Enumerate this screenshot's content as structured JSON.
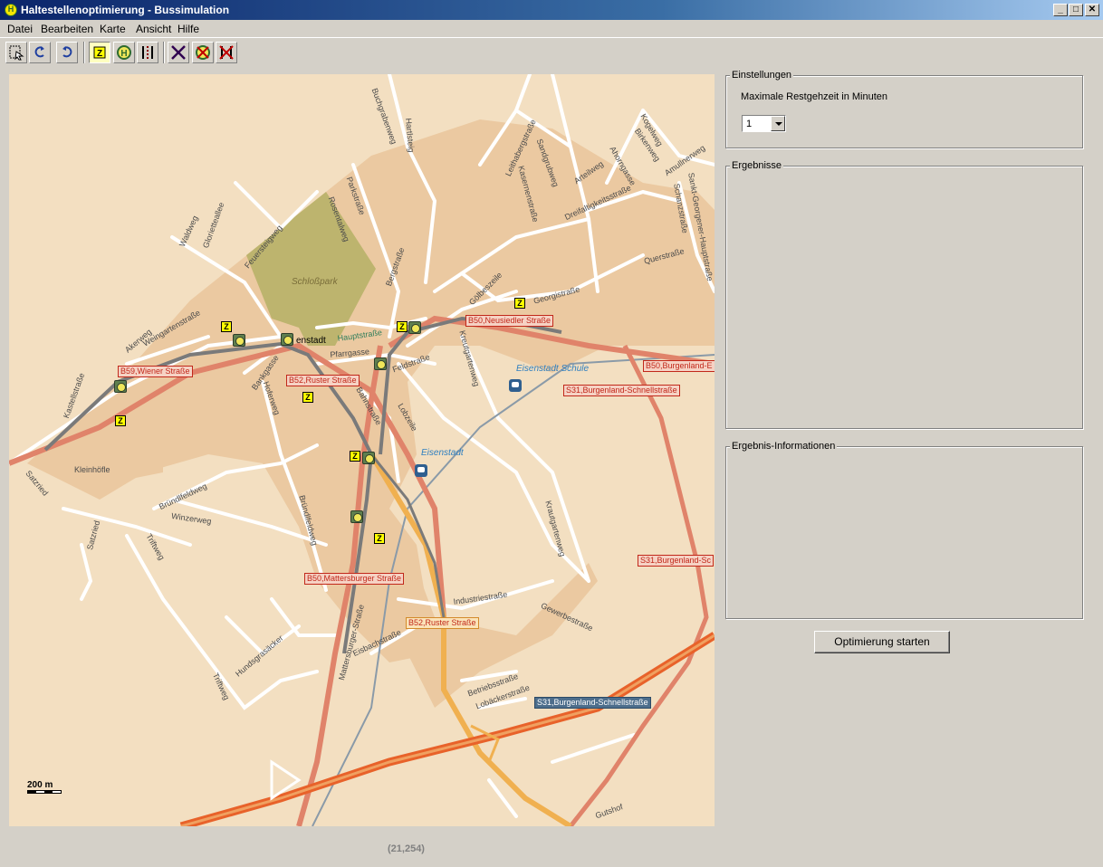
{
  "window": {
    "title": "Haltestellenoptimierung - Bussimulation",
    "app_icon": "H",
    "minimize": "_",
    "maximize": "□",
    "close": "✕"
  },
  "menu": [
    "Datei",
    "Bearbeiten",
    "Karte",
    "Ansicht",
    "Hilfe"
  ],
  "toolbar": {
    "buttons": [
      {
        "icon": "select-icon",
        "active": false
      },
      {
        "icon": "undo-icon",
        "active": false
      },
      {
        "icon": "redo-icon",
        "active": false
      },
      {
        "icon": "z-marker-icon",
        "active": true
      },
      {
        "icon": "bus-stop-icon",
        "active": false
      },
      {
        "icon": "route-icon",
        "active": false
      },
      {
        "icon": "delete-icon",
        "active": false
      },
      {
        "icon": "delete-bus-stop-icon",
        "active": false
      },
      {
        "icon": "delete-route-icon",
        "active": false
      }
    ]
  },
  "map": {
    "park_label": "Schloßpark",
    "town_label": "Eisenstadt",
    "school_label": "Eisenstadt Schule",
    "town_center_label": "enstadt",
    "village_label": "Kleinhöfle",
    "scale_label": "200 m",
    "road_labels": {
      "b59": "B59,Wiener Straße",
      "b50_neusiedler": "B50,Neusiedler Straße",
      "b52_ruster_top": "B52,Ruster Straße",
      "b50_burgenland": "B50,Burgenland-E",
      "s31_top": "S31,Burgenland-Schnellstraße",
      "s31_right": "S31,Burgenland-Sc",
      "b50_mattersburger": "B50,Mattersburger Straße",
      "b52_ruster_bottom": "B52,Ruster Straße",
      "s31_bottom": "S31,Burgenland-Schnellstraße"
    },
    "streets": {
      "buchgrabenweg": "Buchgrabenweg",
      "hartlsteig": "Hartlsteig",
      "leithabergstrasse": "Leithabergstraße",
      "sandgrubweg": "Sandgrubweg",
      "kogelweg": "Kogelweg",
      "birkenweg": "Birkenweg",
      "ahorngasse": "Ahorngasse",
      "arteilweg": "Arteilweg",
      "amullnerweg": "Amullnerweg",
      "parkstrasse": "Parkstraße",
      "rosentalweg": "Rosentalweg",
      "kasernenstrasse": "Kasernenstraße",
      "dreifaltigkeitsstrasse": "Dreifaltigkeitsstraße",
      "schanzstrasse": "Schanzstraße",
      "sankt_georgener": "Sankt-Georgener-Hauptstraße",
      "waldweg": "Waldweg",
      "glorietteallee": "Glorietteallee",
      "feuersteigweg": "Feuersteigweg",
      "bergstrasse": "Bergstraße",
      "querstrasse": "Querstraße",
      "goelbeszeile": "Gölbeszeile",
      "georgistrasse": "Georgistraße",
      "akerweg": "Akerweg",
      "weingartenstrasse": "Weingartenstraße",
      "hauptstrasse": "Hauptstraße",
      "pfarrgasse": "Pfarrgasse",
      "kreutgartenweg": "Kreutgartenweg",
      "feldstrasse": "Feldstraße",
      "bankgasse": "Bankgasse",
      "hoferweg": "Hoferweg",
      "bahnstrasse": "Bahnstraße",
      "lobzeile": "Lobzeile",
      "kastellstrasse": "Kastellstraße",
      "satzried": "Satzried",
      "bruendlfeldweg": "Bründlfeldweg",
      "bruendlfeldweg2": "Bründlfeldweg",
      "winzerweg": "Winzerweg",
      "trifftweg": "Triftweg",
      "satzried2": "Satzried",
      "krautgartenweg": "Krautgartenweg",
      "industriestrasse": "Industriestraße",
      "gewerbestrasse": "Gewerbestraße",
      "hundsgrasaecker": "Hundsgrasäcker",
      "eisbachstrasse": "Eisbachstraße",
      "mattersburger_vert": "Mattersburger-Straße",
      "triftweg2": "Triftweg",
      "betriebsstrasse": "Betriebsstraße",
      "lobaeckerstrasse": "Lobäckerstraße",
      "gutshof": "Gutshof"
    }
  },
  "coordinates": "(21,254)",
  "settings": {
    "group_title": "Einstellungen",
    "label": "Maximale Restgehzeit in Minuten",
    "value": "1"
  },
  "results": {
    "group_title": "Ergebnisse"
  },
  "result_info": {
    "group_title": "Ergebnis-Informationen"
  },
  "start_button": "Optimierung starten"
}
